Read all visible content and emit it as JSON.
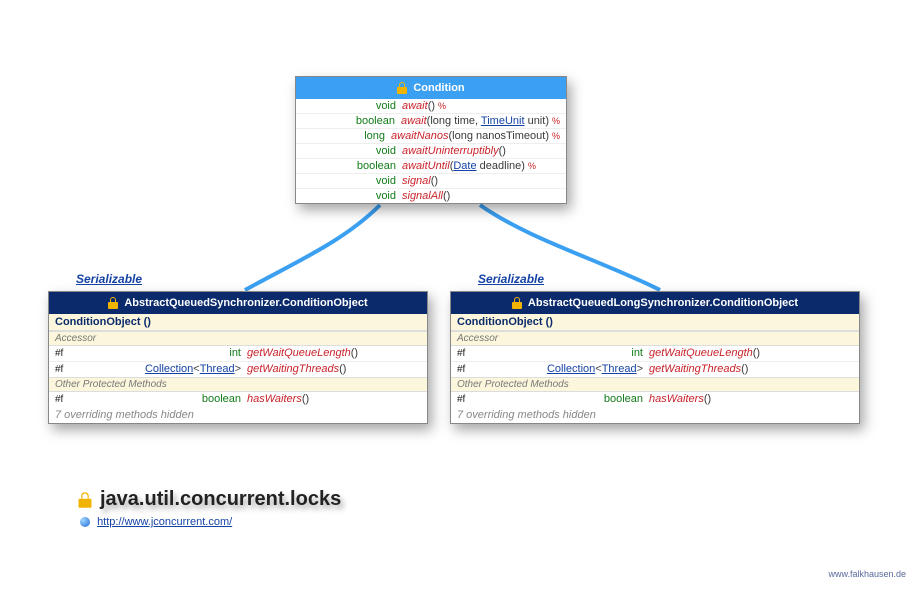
{
  "interface": {
    "title": "Condition",
    "methods": [
      {
        "ret": "void",
        "name": "await",
        "params": "()",
        "throws": true
      },
      {
        "ret": "boolean",
        "name": "await",
        "params_raw": [
          [
            "long",
            " time, "
          ],
          [
            "TimeUnit",
            " unit"
          ]
        ],
        "throws": true
      },
      {
        "ret": "long",
        "name": "awaitNanos",
        "params": "(long nanosTimeout)",
        "throws": true
      },
      {
        "ret": "void",
        "name": "awaitUninterruptibly",
        "params": "()",
        "throws": false
      },
      {
        "ret": "boolean",
        "name": "awaitUntil",
        "params_raw": [
          [
            "Date",
            " deadline"
          ]
        ],
        "throws": true
      },
      {
        "ret": "void",
        "name": "signal",
        "params": "()",
        "throws": false
      },
      {
        "ret": "void",
        "name": "signalAll",
        "params": "()",
        "throws": false
      }
    ]
  },
  "stereotype": "Serializable",
  "left": {
    "title": "AbstractQueuedSynchronizer.ConditionObject",
    "ctor": "ConditionObject ()",
    "sections": {
      "accessor": "Accessor",
      "otherProtected": "Other Protected Methods"
    },
    "accessors": [
      {
        "prot": "#f",
        "ret_plain": "int",
        "name": "getWaitQueueLength",
        "params": "()"
      },
      {
        "prot": "#f",
        "ret_html_collection_thread": true,
        "name": "getWaitingThreads",
        "params": "()"
      }
    ],
    "otherProtected": [
      {
        "prot": "#f",
        "ret_plain": "boolean",
        "name": "hasWaiters",
        "params": "()"
      }
    ],
    "hidden": "7 overriding methods hidden"
  },
  "right": {
    "title": "AbstractQueuedLongSynchronizer.ConditionObject",
    "ctor": "ConditionObject ()",
    "sections": {
      "accessor": "Accessor",
      "otherProtected": "Other Protected Methods"
    },
    "accessors": [
      {
        "prot": "#f",
        "ret_plain": "int",
        "name": "getWaitQueueLength",
        "params": "()"
      },
      {
        "prot": "#f",
        "ret_html_collection_thread": true,
        "name": "getWaitingThreads",
        "params": "()"
      }
    ],
    "otherProtected": [
      {
        "prot": "#f",
        "ret_plain": "boolean",
        "name": "hasWaiters",
        "params": "()"
      }
    ],
    "hidden": "7 overriding methods hidden"
  },
  "package": {
    "name": "java.util.concurrent.locks",
    "url": "http://www.jconcurrent.com/"
  },
  "attribution": "www.falkhausen.de",
  "symbols": {
    "throws": "%"
  }
}
